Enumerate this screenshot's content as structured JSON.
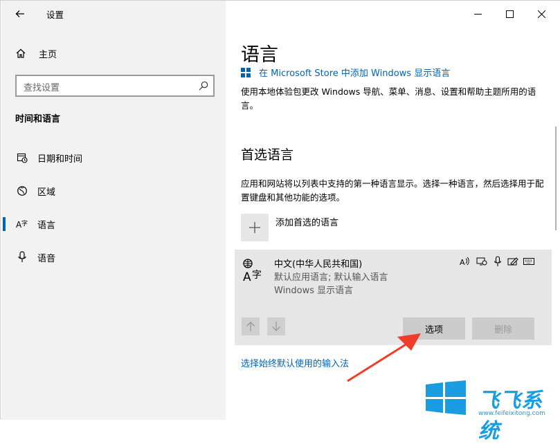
{
  "window": {
    "title": "设置",
    "controls": {
      "minimize": "minimize-icon",
      "maximize": "maximize-icon",
      "close": "close-icon"
    }
  },
  "sidebar": {
    "home_label": "主页",
    "search_placeholder": "查找设置",
    "section_title": "时间和语言",
    "items": [
      {
        "label": "日期和时间",
        "icon": "calendar-clock-icon",
        "selected": false
      },
      {
        "label": "区域",
        "icon": "region-globe-icon",
        "selected": false
      },
      {
        "label": "语言",
        "icon": "language-icon",
        "selected": true
      },
      {
        "label": "语音",
        "icon": "microphone-icon",
        "selected": false
      }
    ]
  },
  "main": {
    "title": "语言",
    "store_link": "在 Microsoft Store 中添加 Windows 显示语言",
    "description": "使用本地体验包更改 Windows 导航、菜单、消息、设置和帮助主题所用的语言。",
    "preferred": {
      "title": "首选语言",
      "description": "应用和网站将以列表中支持的第一种语言显示。选择一种语言，然后选择用于配置键盘和其他功能的选项。",
      "add_label": "添加首选的语言",
      "languages": [
        {
          "name": "中文(中华人民共和国)",
          "detail1": "默认应用语言; 默认输入语言",
          "detail2": "Windows 显示语言",
          "options_label": "选项",
          "remove_label": "删除",
          "features": [
            "text-to-speech-icon",
            "display-icon",
            "microphone-icon",
            "handwriting-icon",
            "keyboard-icon"
          ]
        }
      ]
    },
    "input_method_link": "选择始终默认使用的输入法"
  },
  "watermark": {
    "brand": "飞飞系统",
    "url": "www.feifeixitong.com"
  },
  "colors": {
    "accent": "#0063b1",
    "annotation_arrow": "#f03c2a",
    "watermark": "#1a9ce0"
  }
}
